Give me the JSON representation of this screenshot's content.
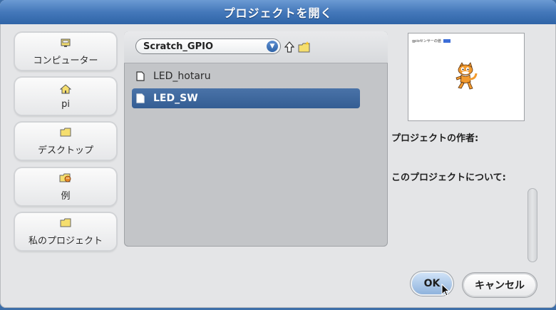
{
  "dialog": {
    "title": "プロジェクトを開く"
  },
  "locations": [
    {
      "label": "コンピューター",
      "icon": "computer-icon"
    },
    {
      "label": "pi",
      "icon": "home-icon"
    },
    {
      "label": "デスクトップ",
      "icon": "folder-icon"
    },
    {
      "label": "例",
      "icon": "examples-icon"
    },
    {
      "label": "私のプロジェクト",
      "icon": "folder-icon"
    }
  ],
  "browser": {
    "path": "Scratch_GPIO",
    "files": [
      {
        "name": "LED_hotaru",
        "selected": false
      },
      {
        "name": "LED_SW",
        "selected": true
      }
    ]
  },
  "preview": {
    "mini_label": "gpioセンサーの値"
  },
  "info": {
    "author_label": "プロジェクトの作者:",
    "about_label": "このプロジェクトについて:"
  },
  "buttons": {
    "ok": "OK",
    "cancel": "キャンセル"
  },
  "colors": {
    "title_bar": "#4478ba",
    "selection": "#3d6498",
    "panel": "#c3c5c8",
    "dialog": "#e4e5e7"
  }
}
